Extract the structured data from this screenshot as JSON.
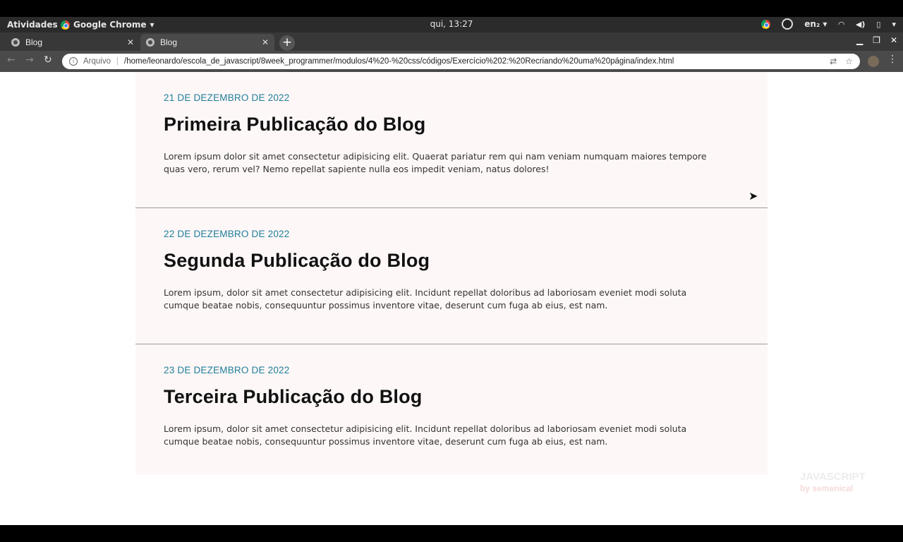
{
  "system_bar": {
    "activities": "Atividades",
    "app_name": "Google Chrome",
    "clock": "qui, 13:27",
    "language": "en₂"
  },
  "browser": {
    "tabs": [
      {
        "label": "Blog",
        "active": false
      },
      {
        "label": "Blog",
        "active": true
      }
    ],
    "omnibox": {
      "scheme_label": "Arquivo",
      "url": "/home/leonardo/escola_de_javascript/8week_programmer/modulos/4%20-%20css/códigos/Exercício%202:%20Recriando%20uma%20página/index.html"
    }
  },
  "posts": [
    {
      "date": "21 DE DEZEMBRO DE 2022",
      "title": "Primeira Publicação do Blog",
      "body": "Lorem ipsum dolor sit amet consectetur adipisicing elit. Quaerat pariatur rem qui nam veniam numquam maiores tempore quas vero, rerum vel? Nemo repellat sapiente nulla eos impedit veniam, natus dolores!"
    },
    {
      "date": "22 DE DEZEMBRO DE 2022",
      "title": "Segunda Publicação do Blog",
      "body": "Lorem ipsum, dolor sit amet consectetur adipisicing elit. Incidunt repellat doloribus ad laboriosam eveniet modi soluta cumque beatae nobis, consequuntur possimus inventore vitae, deserunt cum fuga ab eius, est nam."
    },
    {
      "date": "23 DE DEZEMBRO DE 2022",
      "title": "Terceira Publicação do Blog",
      "body": "Lorem ipsum, dolor sit amet consectetur adipisicing elit. Incidunt repellat doloribus ad laboriosam eveniet modi soluta cumque beatae nobis, consequuntur possimus inventore vitae, deserunt cum fuga ab eius, est nam."
    }
  ],
  "watermark": {
    "line1": "JAVASCRIPT",
    "line2": "by semanical"
  },
  "colors": {
    "date_accent": "#1f7f9b",
    "page_background": "#fef7f7"
  }
}
